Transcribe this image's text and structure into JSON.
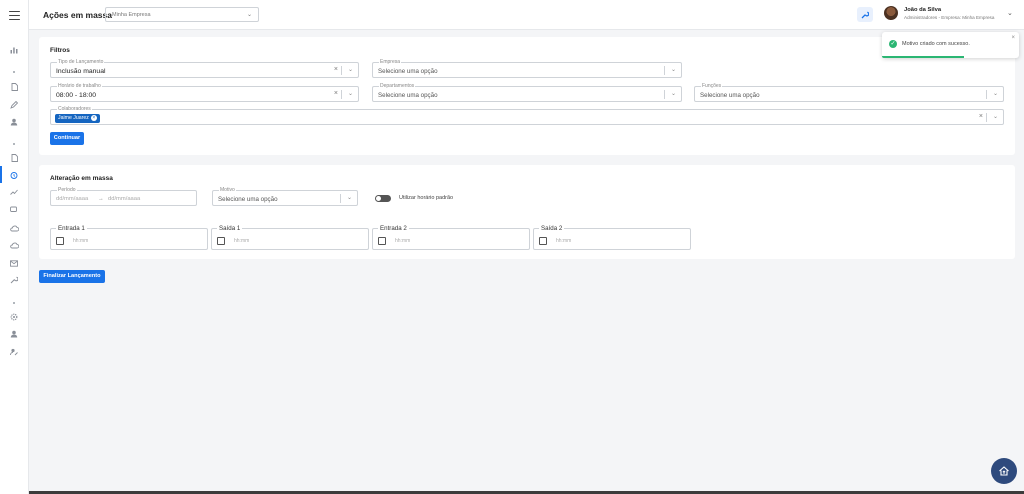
{
  "header": {
    "title": "Ações em massa",
    "company_select": "Minha Empresa",
    "user_name": "João da Silva",
    "user_role": "Administradores - Empresa: Minha Empresa"
  },
  "filters": {
    "title": "Filtros",
    "tipo_label": "Tipo de Lançamento",
    "tipo_value": "Inclusão manual",
    "empresa_label": "Empresa",
    "empresa_placeholder": "Selecione uma opção",
    "horario_label": "Horário de trabalho",
    "horario_value": "08:00 - 18:00",
    "departamentos_label": "Departamentos",
    "departamentos_placeholder": "Selecione uma opção",
    "funcoes_label": "Funções",
    "funcoes_placeholder": "Selecione uma opção",
    "colaboradores_label": "Colaboradores",
    "colaborador_chip": "Jaime Juarez",
    "continue_button": "Continuar"
  },
  "mass_change": {
    "title": "Alteração em massa",
    "periodo_label": "Período",
    "periodo_start_placeholder": "dd/mm/aaaa",
    "periodo_arrow": "→",
    "periodo_end_placeholder": "dd/mm/aaaa",
    "motivo_label": "Motivo",
    "motivo_placeholder": "Selecione uma opção",
    "toggle_label": "Utilizar horário padrão",
    "toggle_on": false,
    "times": [
      {
        "label": "Entrada 1",
        "placeholder": "hh:mm"
      },
      {
        "label": "Saída 1",
        "placeholder": "hh:mm"
      },
      {
        "label": "Entrada 2",
        "placeholder": "hh:mm"
      },
      {
        "label": "Saída 2",
        "placeholder": "hh:mm"
      }
    ]
  },
  "finish_button": "Finalizar Lançamento",
  "toast": {
    "message": "Motivo criado com sucesso.",
    "progress": 0.6
  },
  "icons": {
    "menu": "hamburger-icon",
    "wrench": "wrench-icon",
    "success": "check-circle-icon",
    "fab": "home-upload-icon"
  },
  "colors": {
    "accent": "#1a73e8",
    "chip": "#1565c0",
    "success": "#2bb673",
    "fab": "#2e4a7d"
  }
}
